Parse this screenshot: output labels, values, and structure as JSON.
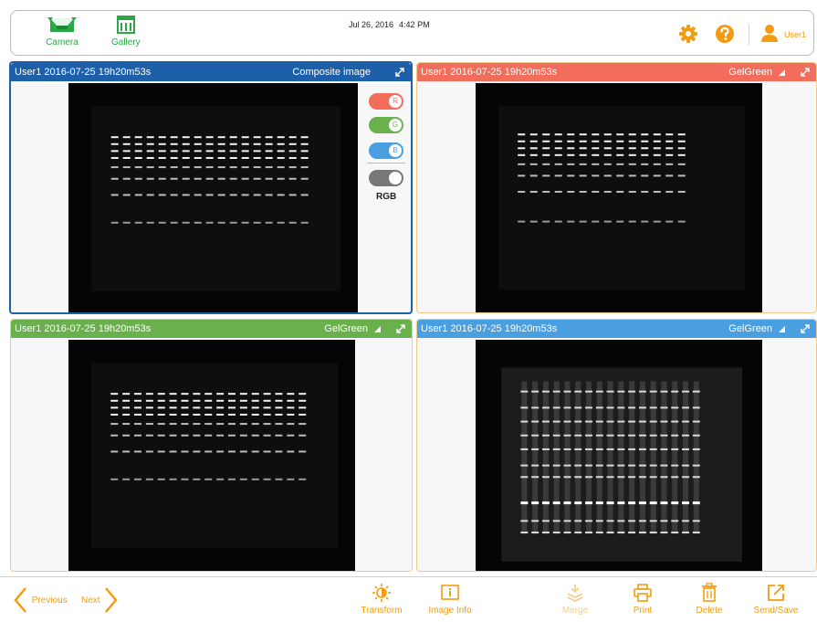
{
  "topbar": {
    "camera_label": "Camera",
    "gallery_label": "Gallery",
    "date": "Jul 26, 2016",
    "time": "4:42 PM",
    "user_label": "User1"
  },
  "panels": [
    {
      "title": "User1 2016-07-25 19h20m53s",
      "channel": "Composite image",
      "header_color": "#1d5fa8"
    },
    {
      "title": "User1 2016-07-25 19h20m53s",
      "channel": "GelGreen",
      "header_color": "#f26d5b"
    },
    {
      "title": "User1 2016-07-25 19h20m53s",
      "channel": "GelGreen",
      "header_color": "#6ab04c"
    },
    {
      "title": "User1 2016-07-25 19h20m53s",
      "channel": "GelGreen",
      "header_color": "#4a9fe0"
    }
  ],
  "channel_toggles": {
    "r_label": "R",
    "g_label": "G",
    "b_label": "B",
    "rgb_label": "RGB",
    "r_color": "#f26d5b",
    "g_color": "#6ab04c",
    "b_color": "#4a9fe0",
    "rgb_color": "#777777"
  },
  "bottombar": {
    "previous_label": "Previous",
    "next_label": "Next",
    "transform_label": "Transform",
    "image_info_label": "Image Info",
    "merge_label": "Merge",
    "print_label": "Print",
    "delete_label": "Delete",
    "send_save_label": "Send/Save"
  },
  "colors": {
    "accent_orange": "#f39c12",
    "accent_green": "#2aa845",
    "active_panel_border": "#1d5fa8"
  }
}
